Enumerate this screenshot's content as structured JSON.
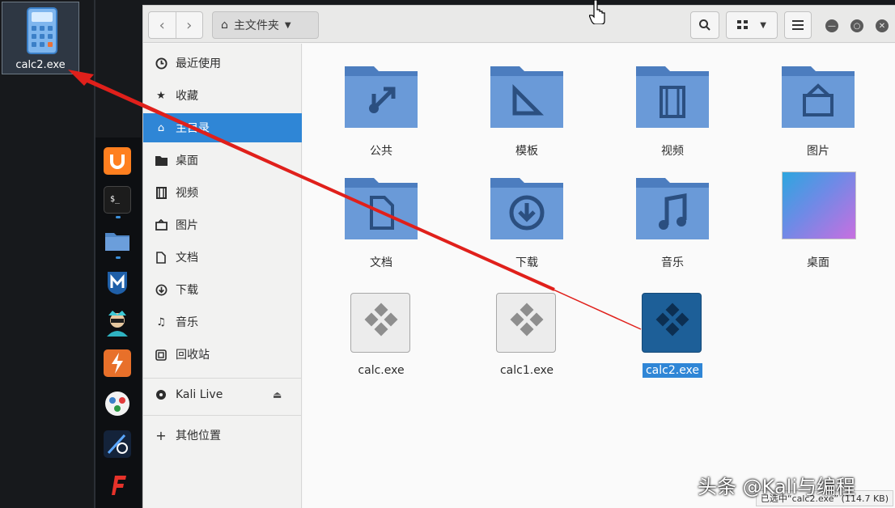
{
  "desktop": {
    "icon_label": "calc2.exe"
  },
  "header": {
    "location": "主文件夹"
  },
  "sidebar": {
    "items": [
      {
        "label": "最近使用",
        "icon": "clock-icon"
      },
      {
        "label": "收藏",
        "icon": "star-icon"
      },
      {
        "label": "主目录",
        "icon": "home-icon",
        "active": true
      },
      {
        "label": "桌面",
        "icon": "folder-icon"
      },
      {
        "label": "视频",
        "icon": "film-icon"
      },
      {
        "label": "图片",
        "icon": "camera-icon"
      },
      {
        "label": "文档",
        "icon": "document-icon"
      },
      {
        "label": "下载",
        "icon": "download-icon"
      },
      {
        "label": "音乐",
        "icon": "music-icon"
      },
      {
        "label": "回收站",
        "icon": "trash-icon"
      }
    ],
    "devices": [
      {
        "label": "Kali Live",
        "icon": "disk-icon"
      }
    ],
    "other": {
      "label": "其他位置",
      "icon": "plus-icon"
    }
  },
  "grid": {
    "folders": [
      {
        "label": "公共",
        "icon": "share-icon"
      },
      {
        "label": "模板",
        "icon": "template-icon"
      },
      {
        "label": "视频",
        "icon": "film-icon"
      },
      {
        "label": "图片",
        "icon": "camera-icon"
      },
      {
        "label": "文档",
        "icon": "document-icon"
      },
      {
        "label": "下载",
        "icon": "download-icon"
      },
      {
        "label": "音乐",
        "icon": "music-icon"
      },
      {
        "label": "桌面",
        "icon": "wallpaper-icon"
      }
    ],
    "files": [
      {
        "label": "calc.exe"
      },
      {
        "label": "calc1.exe"
      },
      {
        "label": "calc2.exe",
        "selected": true
      }
    ]
  },
  "status": {
    "text": "已选中“calc2.exe” (114.7 KB)"
  },
  "watermark": {
    "text": "头条 @Kali与编程"
  },
  "colors": {
    "accent": "#2f86d6",
    "folder": "#5f8fcf",
    "annotation": "#e0201b"
  }
}
